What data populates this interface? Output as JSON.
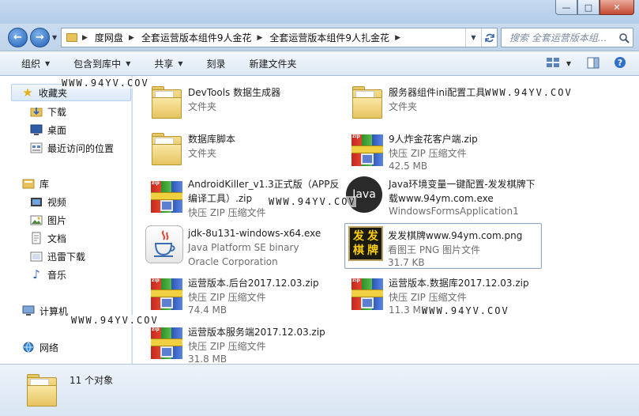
{
  "window": {
    "minimize_glyph": "—",
    "maximize_glyph": "□",
    "close_glyph": "✕"
  },
  "nav": {
    "back_glyph": "←",
    "forward_glyph": "→",
    "breadcrumbs": [
      "度网盘",
      "全套运营版本组件9人金花",
      "全套运营版本组件9人扎金花"
    ],
    "search_placeholder": "搜索 全套运营版本组..."
  },
  "toolbar": {
    "organize": "组织",
    "include_in_library": "包含到库中",
    "share": "共享",
    "burn": "刻录",
    "new_folder": "新建文件夹"
  },
  "sidebar": {
    "favorites": "收藏夹",
    "favorites_items": [
      "下载",
      "桌面",
      "最近访问的位置"
    ],
    "libraries": "库",
    "libraries_items": [
      "视频",
      "图片",
      "文档",
      "迅雷下载",
      "音乐"
    ],
    "computer": "计算机",
    "network": "网络"
  },
  "files": [
    {
      "name": "DevTools 数据生成器",
      "type": "文件夹",
      "size": "",
      "icon": "folder-icon"
    },
    {
      "name": "服务器组件ini配置工具",
      "type": "文件夹",
      "size": "",
      "icon": "folder-icon"
    },
    {
      "name": "数据库脚本",
      "type": "文件夹",
      "size": "",
      "icon": "folder-icon"
    },
    {
      "name": "9人炸金花客户端.zip",
      "type": "快压 ZIP 压缩文件",
      "size": "42.5 MB",
      "icon": "zip-icon"
    },
    {
      "name": "AndroidKiller_v1.3正式版（APP反编译工具）.zip",
      "name_line1": "AndroidKiller_v1.3正式版（APP反",
      "name_line2": "编译工具）.zip",
      "type": "快压 ZIP 压缩文件",
      "size": "",
      "icon": "zip-icon"
    },
    {
      "name": "Java环境变量一键配置-发发棋牌下载www.94ym.com.exe",
      "name_line1": "Java环境变量一键配置-发发棋牌下",
      "name_line2": "载www.94ym.com.exe",
      "type": "WindowsFormsApplication1",
      "size": "",
      "icon": "java-icon",
      "icon_text": "Java"
    },
    {
      "name": "jdk-8u131-windows-x64.exe",
      "type": "Java Platform SE binary",
      "size": "Oracle Corporation",
      "icon": "java-cup-icon"
    },
    {
      "name": "发发棋牌www.94ym.com.png",
      "type": "看图王 PNG 图片文件",
      "size": "31.7 KB",
      "icon": "image-thumbnail-icon",
      "thumb_chars": [
        "发",
        "发",
        "棋",
        "牌"
      ]
    },
    {
      "name": "运营版本.后台2017.12.03.zip",
      "type": "快压 ZIP 压缩文件",
      "size": "74.4 MB",
      "icon": "zip-icon"
    },
    {
      "name": "运营版本.数据库2017.12.03.zip",
      "type": "快压 ZIP 压缩文件",
      "size": "11.3 MB",
      "icon": "zip-icon"
    },
    {
      "name": "运营版本服务端2017.12.03.zip",
      "type": "快压 ZIP 压缩文件",
      "size": "31.8 MB",
      "icon": "zip-icon"
    }
  ],
  "zip_tag": "zip",
  "watermark": "WWW.94YV.COV",
  "status": {
    "count_text": "11 个对象"
  }
}
